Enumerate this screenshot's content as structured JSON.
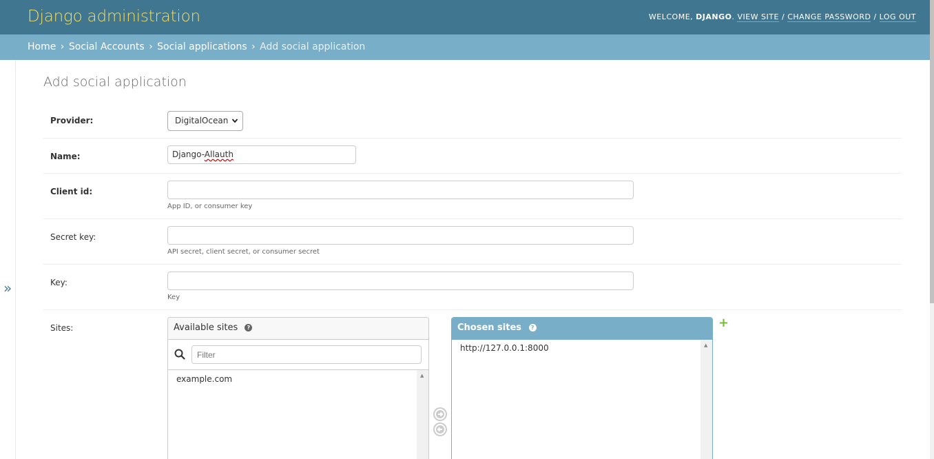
{
  "header": {
    "brand": "Django administration",
    "welcome": "Welcome,",
    "user": "Django",
    "view_site": "View site",
    "change_password": "Change password",
    "log_out": "Log out",
    "sep": "/"
  },
  "breadcrumbs": {
    "home": "Home",
    "app": "Social Accounts",
    "model": "Social applications",
    "current": "Add social application",
    "sep": "›"
  },
  "sidebar": {
    "toggle_glyph": "»"
  },
  "page": {
    "title": "Add social application"
  },
  "form": {
    "provider": {
      "label": "Provider:",
      "selected": "DigitalOcean"
    },
    "name": {
      "label": "Name:",
      "value_first": "Django-",
      "value_rest": "Allauth"
    },
    "client_id": {
      "label": "Client id:",
      "value": "",
      "help": "App ID, or consumer key"
    },
    "secret_key": {
      "label": "Secret key:",
      "value": "",
      "help": "API secret, client secret, or consumer secret"
    },
    "key": {
      "label": "Key:",
      "value": "",
      "help": "Key"
    },
    "sites": {
      "label": "Sites:",
      "available_title": "Available sites",
      "filter_placeholder": "Filter",
      "available_options": [
        "example.com"
      ],
      "chosen_title": "Chosen sites",
      "chosen_options": [
        "http://127.0.0.1:8000"
      ],
      "help_glyph": "?",
      "add_glyph": "+"
    }
  },
  "colors": {
    "header": "#417690",
    "breadcrumbs": "#79aec8",
    "brand": "#f5dd5d",
    "add": "#70bf2b"
  }
}
